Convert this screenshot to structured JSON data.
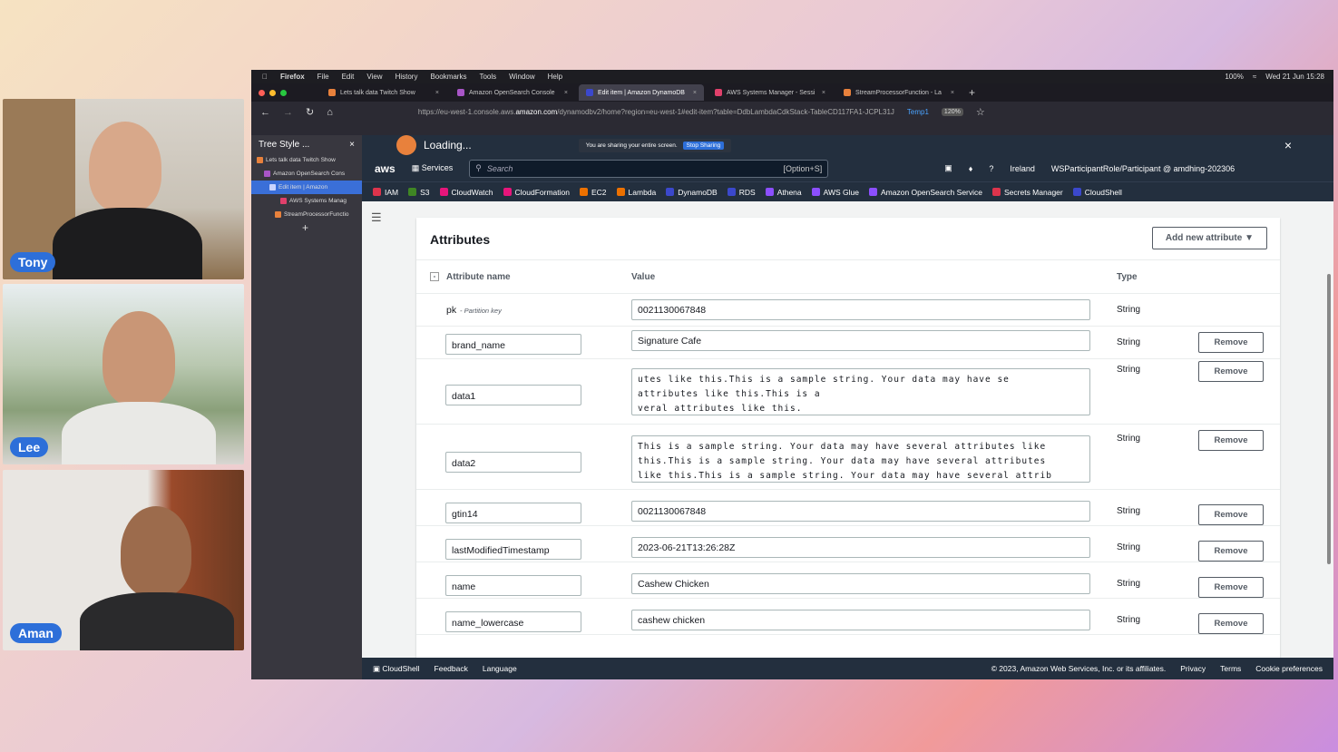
{
  "participants": [
    {
      "name": "Tony"
    },
    {
      "name": "Lee"
    },
    {
      "name": "Aman"
    }
  ],
  "menubar": {
    "items": [
      "Firefox",
      "File",
      "Edit",
      "View",
      "History",
      "Bookmarks",
      "Tools",
      "Window",
      "Help"
    ],
    "battery": "100%",
    "datetime": "Wed 21 Jun 15:28"
  },
  "tabs": [
    {
      "label": "Lets talk data Twitch Show"
    },
    {
      "label": "Amazon OpenSearch Console"
    },
    {
      "label": "Edit item | Amazon DynamoDB"
    },
    {
      "label": "AWS Systems Manager - Sessi"
    },
    {
      "label": "StreamProcessorFunction - La"
    }
  ],
  "urlbar": {
    "url_prefix": "https://eu-west-1.console.aws.",
    "url_domain": "amazon.com",
    "url_suffix": "/dynamodbv2/home?region=eu-west-1#edit-item?table=DdbLambdaCdkStack-TableCD117FA1-JCPL31J",
    "container": "Temp1",
    "zoom": "120%"
  },
  "sidebar": {
    "title": "Tree Style ...",
    "items": [
      {
        "label": "Lets talk data Twitch Show",
        "color": "#e8813c"
      },
      {
        "label": "Amazon OpenSearch Cons",
        "color": "#a855c7"
      },
      {
        "label": "Edit item | Amazon",
        "color": "#3a6fd8"
      },
      {
        "label": "AWS Systems Manag",
        "color": "#e0406b"
      },
      {
        "label": "StreamProcessorFunctio",
        "color": "#e8813c"
      }
    ],
    "add": "+"
  },
  "loading": {
    "text": "Loading...",
    "share_text": "You are sharing your entire screen.",
    "stop_text": "Stop Sharing"
  },
  "awsnav": {
    "logo": "aws",
    "services": "Services",
    "search_placeholder": "Search",
    "search_kbd": "[Option+S]",
    "region": "Ireland",
    "account": "WSParticipantRole/Participant @ amdhing-202306"
  },
  "bookmarks": [
    {
      "label": "IAM",
      "color": "#dd344c"
    },
    {
      "label": "S3",
      "color": "#3f8624"
    },
    {
      "label": "CloudWatch",
      "color": "#e7157b"
    },
    {
      "label": "CloudFormation",
      "color": "#e7157b"
    },
    {
      "label": "EC2",
      "color": "#ed7100"
    },
    {
      "label": "Lambda",
      "color": "#ed7100"
    },
    {
      "label": "DynamoDB",
      "color": "#3b48cc"
    },
    {
      "label": "RDS",
      "color": "#3b48cc"
    },
    {
      "label": "Athena",
      "color": "#8c4fff"
    },
    {
      "label": "AWS Glue",
      "color": "#8c4fff"
    },
    {
      "label": "Amazon OpenSearch Service",
      "color": "#8c4fff"
    },
    {
      "label": "Secrets Manager",
      "color": "#dd344c"
    },
    {
      "label": "CloudShell",
      "color": "#3b48cc"
    }
  ],
  "panel": {
    "title": "Attributes",
    "add_button": "Add new attribute",
    "columns": {
      "name": "Attribute name",
      "value": "Value",
      "type": "Type"
    },
    "pk": {
      "name": "pk",
      "hint": "- Partition key",
      "value": "0021130067848",
      "type": "String"
    },
    "rows": [
      {
        "name": "brand_name",
        "value": "Signature Cafe",
        "type": "String",
        "remove": "Remove"
      },
      {
        "name": "data1",
        "lines": [
          "utes like this.This is a sample string. Your data may have se",
          "attributes like this.This is a",
          "veral attributes like this."
        ],
        "type": "String",
        "remove": "Remove"
      },
      {
        "name": "data2",
        "lines": [
          "This is a sample string. Your data may have several attributes like",
          "this.This is a sample string. Your data may have several attributes",
          "like this.This is a sample string. Your data may have several attrib"
        ],
        "type": "String",
        "remove": "Remove"
      },
      {
        "name": "gtin14",
        "value": "0021130067848",
        "type": "String",
        "remove": "Remove"
      },
      {
        "name": "lastModifiedTimestamp",
        "value": "2023-06-21T13:26:28Z",
        "type": "String",
        "remove": "Remove"
      },
      {
        "name": "name",
        "value": "Cashew Chicken",
        "type": "String",
        "remove": "Remove"
      },
      {
        "name": "name_lowercase",
        "value": "cashew chicken",
        "type": "String",
        "remove": "Remove"
      }
    ]
  },
  "footer": {
    "cloudshell": "CloudShell",
    "feedback": "Feedback",
    "language": "Language",
    "copyright": "© 2023, Amazon Web Services, Inc. or its affiliates.",
    "privacy": "Privacy",
    "terms": "Terms",
    "cookies": "Cookie preferences"
  }
}
